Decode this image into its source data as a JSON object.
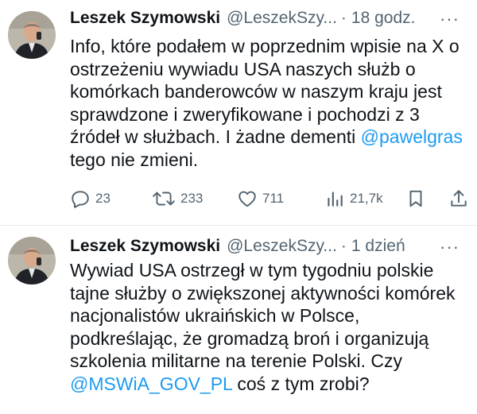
{
  "tweets": [
    {
      "name": "Leszek Szymowski",
      "handle": "@LeszekSzy...",
      "time": "18 godz.",
      "more": "···",
      "text_before": "Info, które podałem w poprzednim wpisie na X o ostrzeżeniu wywiadu USA naszych służb o komórkach banderowców w naszym kraju jest sprawdzone i zweryfikowane i pochodzi z 3 źródeł w służbach. I żadne dementi ",
      "mention": "@pawelgras",
      "text_after": " tego nie zmieni.",
      "stats": {
        "replies": "23",
        "retweets": "233",
        "likes": "711",
        "views": "21,7k"
      }
    },
    {
      "name": "Leszek Szymowski",
      "handle": "@LeszekSzy...",
      "time": "1 dzień",
      "more": "···",
      "text_before": "Wywiad USA ostrzegł w tym tygodniu polskie tajne służby o zwiększonej aktywności komórek nacjonalistów ukraińskich w Polsce, podkreślając, że gromadzą broń i organizują szkolenia militarne na terenie Polski. Czy ",
      "mention": "@MSWiA_GOV_PL",
      "text_after": " coś z tym zrobi?"
    }
  ],
  "icons": {
    "reply": "reply-icon",
    "retweet": "retweet-icon",
    "like": "heart-icon",
    "views": "views-icon",
    "bookmark": "bookmark-icon",
    "share": "share-icon"
  },
  "colors": {
    "text": "#0f1419",
    "secondary": "#536471",
    "link": "#1d9bf0",
    "divider": "#e7e9ea"
  }
}
